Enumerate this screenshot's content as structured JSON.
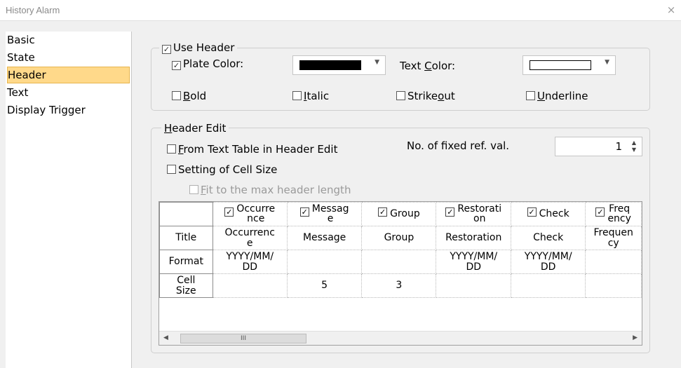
{
  "window": {
    "title": "History Alarm",
    "close": "×"
  },
  "sidebar": {
    "items": [
      {
        "label": "Basic"
      },
      {
        "label": "State"
      },
      {
        "label": "Header"
      },
      {
        "label": "Text"
      },
      {
        "label": "Display Trigger"
      }
    ],
    "selected_index": 2
  },
  "use_header": {
    "legend": "Use Header",
    "checked": true,
    "plate_color_label": "Plate Color:",
    "plate_color_checked": true,
    "plate_color": "#000000",
    "text_color_label_pre": "Text ",
    "text_color_label_u": "C",
    "text_color_label_post": "olor:",
    "text_color": "#ffffff",
    "bold": {
      "u": "B",
      "rest": "old",
      "checked": false
    },
    "italic": {
      "u": "I",
      "rest": "talic",
      "checked": false
    },
    "strikeout": {
      "pre": "Strike",
      "u": "o",
      "post": "ut",
      "checked": false
    },
    "underline": {
      "u": "U",
      "rest": "nderline",
      "checked": false
    }
  },
  "header_edit": {
    "legend_u": "H",
    "legend_rest": "eader Edit",
    "from_text_table": {
      "u": "F",
      "rest": "rom Text Table in Header Edit",
      "checked": false
    },
    "fixed_ref_label": "No. of fixed ref. val.",
    "fixed_ref_value": "1",
    "cell_size": {
      "label": "Setting of Cell Size",
      "checked": false
    },
    "fit_max": {
      "u": "F",
      "rest": "it to the max header length",
      "checked": false,
      "disabled": true
    }
  },
  "grid": {
    "header_cols": [
      {
        "line1": "Occurre",
        "line2": "nce",
        "checked": true
      },
      {
        "line1": "Messag",
        "line2": "e",
        "checked": true
      },
      {
        "line1": "Group",
        "line2": "",
        "checked": true
      },
      {
        "line1": "Restorati",
        "line2": "on",
        "checked": true
      },
      {
        "line1": "Check",
        "line2": "",
        "checked": true
      },
      {
        "line1": "Freq",
        "line2": "ency",
        "checked": true
      }
    ],
    "rows": [
      {
        "head": "Title",
        "cells": [
          [
            "Occurrenc",
            "e"
          ],
          [
            "Message",
            ""
          ],
          [
            "Group",
            ""
          ],
          [
            "Restoration",
            ""
          ],
          [
            "Check",
            ""
          ],
          [
            "Frequen",
            "cy"
          ]
        ]
      },
      {
        "head": "Format",
        "cells": [
          [
            "YYYY/MM/",
            "DD"
          ],
          [
            "",
            ""
          ],
          [
            "",
            ""
          ],
          [
            "YYYY/MM/",
            "DD"
          ],
          [
            "YYYY/MM/",
            "DD"
          ],
          [
            "",
            ""
          ]
        ]
      },
      {
        "head_line1": "Cell",
        "head_line2": "Size",
        "cells": [
          [
            "",
            ""
          ],
          [
            "5",
            ""
          ],
          [
            "3",
            ""
          ],
          [
            "",
            ""
          ],
          [
            "",
            ""
          ],
          [
            "",
            ""
          ]
        ]
      }
    ],
    "scroll_thumb": "III"
  }
}
